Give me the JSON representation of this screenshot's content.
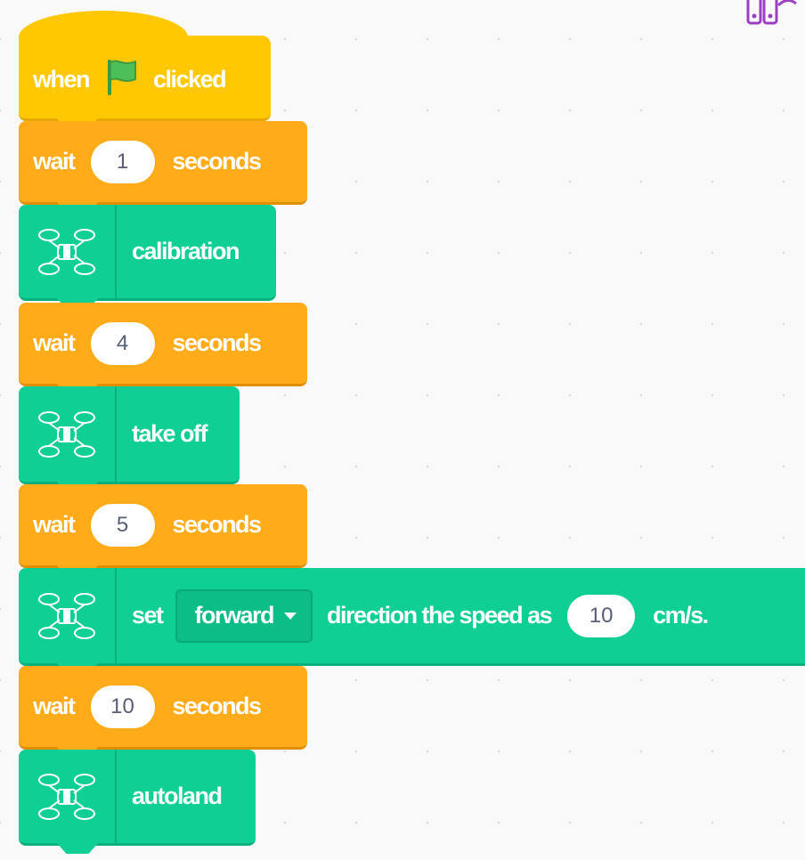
{
  "colors": {
    "events": "#ffc800",
    "control": "#ffab1a",
    "drone": "#0fcf95",
    "flag": "#4cbf56",
    "extension_icon": "#9b3fc3"
  },
  "icons": {
    "flag": "green-flag-icon",
    "drone": "drone-icon",
    "extension": "extension-icon"
  },
  "script": {
    "hat": {
      "when": "when",
      "clicked": "clicked"
    },
    "wait1": {
      "label": "wait",
      "value": "1",
      "unit": "seconds"
    },
    "calibration": {
      "label": "calibration"
    },
    "wait2": {
      "label": "wait",
      "value": "4",
      "unit": "seconds"
    },
    "takeoff": {
      "label": "take off"
    },
    "wait3": {
      "label": "wait",
      "value": "5",
      "unit": "seconds"
    },
    "set_speed": {
      "set": "set",
      "direction": "forward",
      "middle": "direction the speed as",
      "value": "10",
      "unit": "cm/s."
    },
    "wait4": {
      "label": "wait",
      "value": "10",
      "unit": "seconds"
    },
    "autoland": {
      "label": "autoland"
    }
  }
}
